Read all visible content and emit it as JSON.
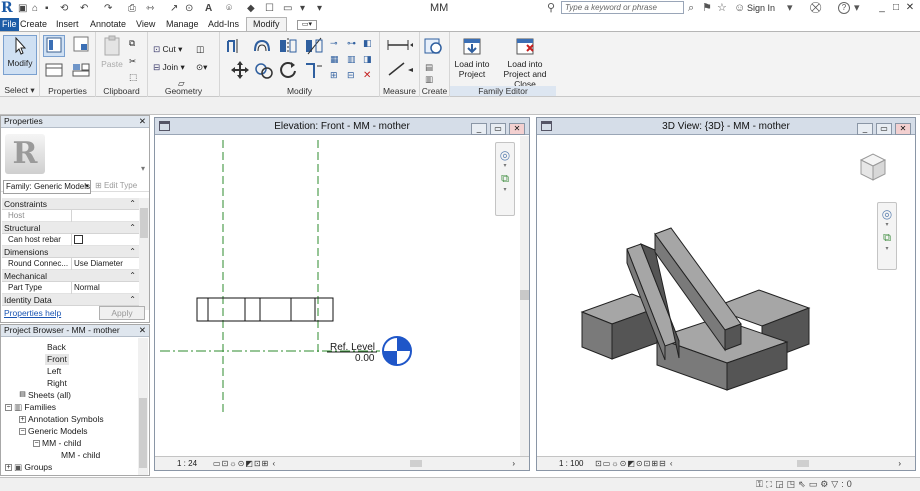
{
  "app": {
    "doc_title": "MM",
    "search_placeholder": "Type a keyword or phrase",
    "signin": "Sign In",
    "help_glyph": "?",
    "min_glyph": "_",
    "restore_glyph": "□",
    "close_glyph": "✕"
  },
  "tabs": [
    "File",
    "Create",
    "Insert",
    "Annotate",
    "View",
    "Manage",
    "Add-Ins",
    "Modify"
  ],
  "ribbon": {
    "modify_label": "Modify",
    "select_label": "Select",
    "properties_label": "Properties",
    "paste_label": "Paste",
    "cut_label": "Cut",
    "join_label": "Join",
    "clipboard_label": "Clipboard",
    "geometry_label": "Geometry",
    "modify_panel_label": "Modify",
    "measure_label": "Measure",
    "create_label": "Create",
    "load_into_project": "Load into Project",
    "load_into_project_close": "Load into Project and Close",
    "family_editor_label": "Family Editor"
  },
  "properties": {
    "title": "Properties",
    "family_type": "Family: Generic Models",
    "edit_type": "Edit Type",
    "groups": [
      {
        "name": "Constraints",
        "rows": [
          {
            "key": "Host",
            "value": "",
            "dim": true
          }
        ]
      },
      {
        "name": "Structural",
        "rows": [
          {
            "key": "Can host rebar",
            "value": "",
            "checkbox": true
          }
        ]
      },
      {
        "name": "Dimensions",
        "rows": [
          {
            "key": "Round Connec...",
            "value": "Use Diameter"
          }
        ]
      },
      {
        "name": "Mechanical",
        "rows": [
          {
            "key": "Part Type",
            "value": "Normal"
          }
        ]
      },
      {
        "name": "Identity Data",
        "rows": []
      }
    ],
    "help_link": "Properties help",
    "apply": "Apply"
  },
  "browser": {
    "title": "Project Browser - MM - mother",
    "items": [
      {
        "label": "Back",
        "indent": 44,
        "selected": false
      },
      {
        "label": "Front",
        "indent": 44,
        "selected": true
      },
      {
        "label": "Left",
        "indent": 44,
        "selected": false
      },
      {
        "label": "Right",
        "indent": 44,
        "selected": false
      },
      {
        "label": "Sheets (all)",
        "indent": 30,
        "selected": false
      },
      {
        "label": "Families",
        "indent": 30,
        "selected": false
      },
      {
        "label": "Annotation Symbols",
        "indent": 32,
        "selected": false
      },
      {
        "label": "Generic Models",
        "indent": 32,
        "selected": false
      },
      {
        "label": "MM - child",
        "indent": 46,
        "selected": false
      },
      {
        "label": "MM - child",
        "indent": 60,
        "selected": false
      },
      {
        "label": "Groups",
        "indent": 30,
        "selected": false
      }
    ]
  },
  "elevation_view": {
    "title": "Elevation: Front - MM - mother",
    "scale": "1 : 24",
    "level_name": "Ref. Level",
    "level_value": "0.00"
  },
  "threed_view": {
    "title": "3D View: {3D} - MM - mother",
    "scale": "1 : 100",
    "viewcube_label": "FRONT"
  },
  "colors": {
    "accent": "#1d5da7",
    "level_marker": "#1f56c8",
    "refplane_green": "#2e8b2e",
    "box_side_dark": "#555555",
    "box_top": "#a6a6a6",
    "box_side_light": "#7a7a7a"
  }
}
